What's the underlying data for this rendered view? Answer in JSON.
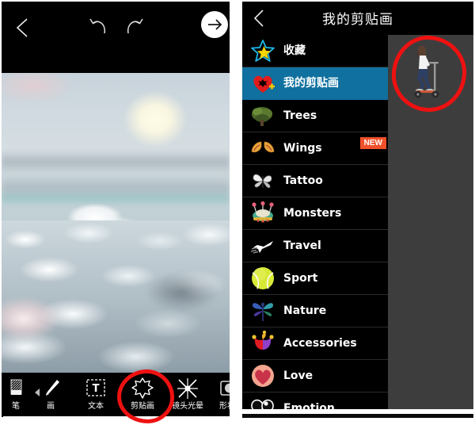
{
  "left_screen": {
    "topbar": {
      "back_icon": "chevron-left-icon",
      "undo_icon": "undo-arrow-icon",
      "redo_icon": "redo-arrow-icon",
      "next_icon": "arrow-right-icon"
    },
    "canvas": {
      "image_description": "aerial photo of clouds and sky from an airplane window"
    },
    "toolbar": {
      "scroll_hint_icon": "left-arrow-icon",
      "tools": [
        {
          "label": "笔",
          "icon": "eraser-icon"
        },
        {
          "label": "画",
          "icon": "brush-icon"
        },
        {
          "label": "文本",
          "icon": "text-box-icon"
        },
        {
          "label": "剪贴画",
          "icon": "clipart-star-icon",
          "selected": true
        },
        {
          "label": "镜头光晕",
          "icon": "lens-flare-icon"
        },
        {
          "label": "形状遮",
          "icon": "shape-mask-icon"
        }
      ]
    },
    "annotation": {
      "shape": "red-hand-drawn-circle",
      "color": "#ee1111",
      "target": "剪贴画"
    }
  },
  "right_screen": {
    "topbar": {
      "back_icon": "chevron-left-icon",
      "title": "我的剪贴画"
    },
    "categories": [
      {
        "label": "收藏",
        "icon": "star-favorite-icon",
        "selected": false,
        "badge": ""
      },
      {
        "label": "我的剪贴画",
        "icon": "heart-plus-icon",
        "selected": true,
        "badge": ""
      },
      {
        "label": "Trees",
        "icon": "tree-icon",
        "selected": false,
        "badge": ""
      },
      {
        "label": "Wings",
        "icon": "wings-icon",
        "selected": false,
        "badge": "NEW"
      },
      {
        "label": "Tattoo",
        "icon": "tattoo-butterfly-icon",
        "selected": false,
        "badge": ""
      },
      {
        "label": "Monsters",
        "icon": "monster-alien-icon",
        "selected": false,
        "badge": ""
      },
      {
        "label": "Travel",
        "icon": "airplane-icon",
        "selected": false,
        "badge": ""
      },
      {
        "label": "Sport",
        "icon": "tennis-ball-icon",
        "selected": false,
        "badge": ""
      },
      {
        "label": "Nature",
        "icon": "dragonfly-icon",
        "selected": false,
        "badge": ""
      },
      {
        "label": "Accessories",
        "icon": "jester-hat-icon",
        "selected": false,
        "badge": ""
      },
      {
        "label": "Love",
        "icon": "heart-icon",
        "selected": false,
        "badge": ""
      },
      {
        "label": "Emotion",
        "icon": "crying-eyes-icon",
        "selected": false,
        "badge": ""
      }
    ],
    "thumbnail_pane": {
      "items": [
        {
          "name": "woman-on-scooter-sticker"
        }
      ]
    },
    "annotation": {
      "shape": "red-hand-drawn-circle",
      "color": "#ee1111",
      "target": "woman-on-scooter-sticker"
    }
  },
  "colors": {
    "selection_blue": "#10709f",
    "badge_orange": "#f0502a",
    "annotation_red": "#ee1111",
    "panel_black": "#000000",
    "thumb_pane_gray": "#3d3d3d"
  }
}
